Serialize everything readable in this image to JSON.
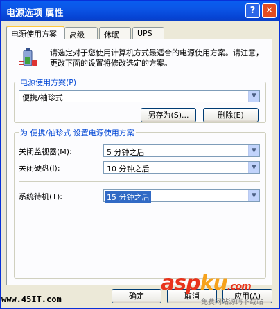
{
  "window": {
    "title": "电源选项 属性",
    "help_glyph": "?",
    "close_glyph": "✕"
  },
  "tabs": [
    {
      "label": "电源使用方案"
    },
    {
      "label": "高级"
    },
    {
      "label": "休眠"
    },
    {
      "label": "UPS"
    }
  ],
  "intro": {
    "icon": "battery-plug-icon",
    "text": "请选定对于您使用计算机方式最适合的电源使用方案。请注意，更改下面的设置将修改选定的方案。"
  },
  "scheme_group": {
    "title": "电源使用方案(P)",
    "selected": "便携/袖珍式",
    "save_as": "另存为(S)...",
    "delete": "删除(E)"
  },
  "settings_group": {
    "title": "为 便携/袖珍式 设置电源使用方案",
    "rows": [
      {
        "label": "关闭监视器(M):",
        "value": "5 分钟之后"
      },
      {
        "label": "关闭硬盘(I):",
        "value": "10 分钟之后"
      },
      {
        "label": "系统待机(T):",
        "value": "15 分钟之后"
      }
    ]
  },
  "footer": {
    "ok": "确定",
    "cancel": "取消",
    "apply": "应用(A)"
  },
  "watermarks": {
    "left": "www.45IT.com",
    "brand_a": "asp",
    "brand_b": "ku",
    "brand_c": ".com",
    "sub": "免费网站源码下载站"
  }
}
